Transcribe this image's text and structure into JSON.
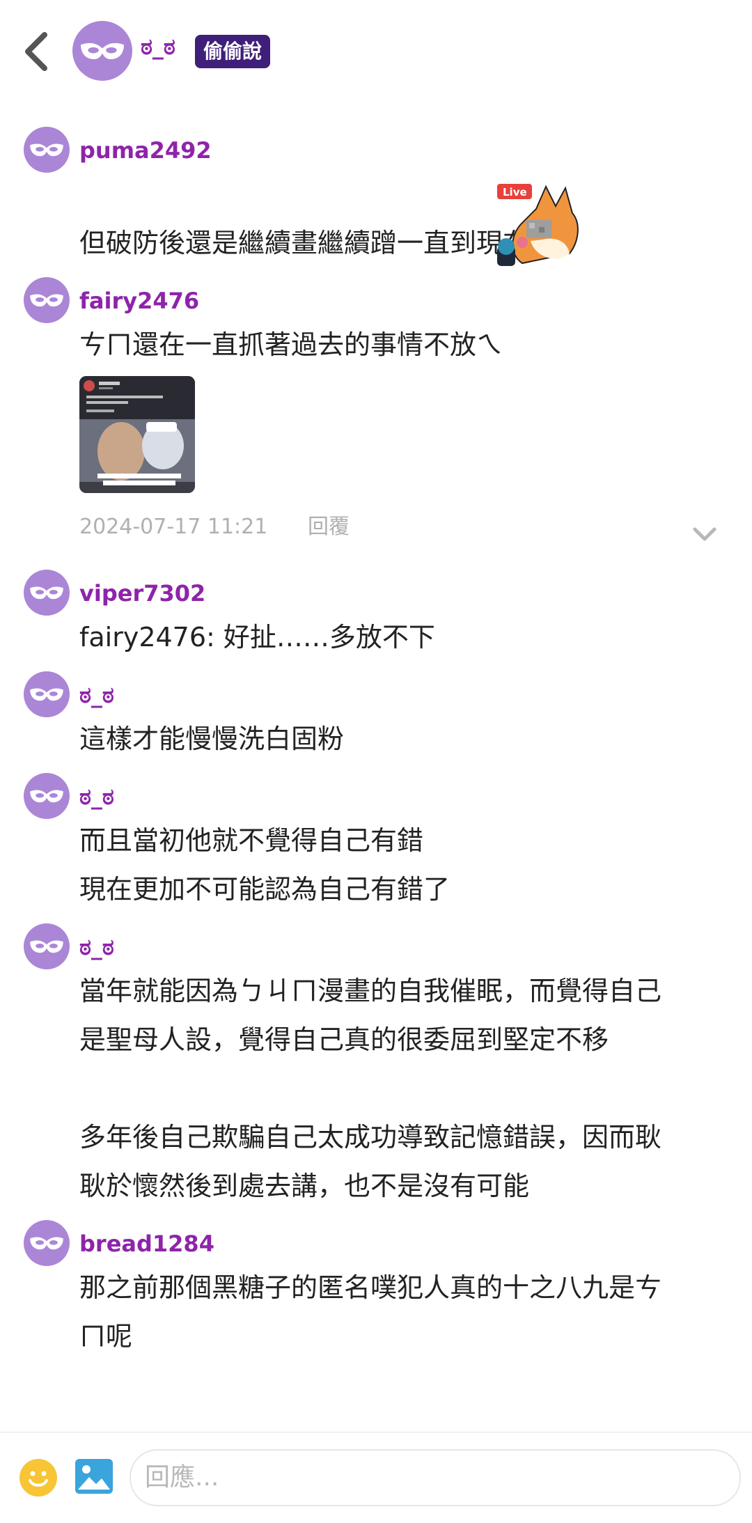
{
  "header": {
    "username": "ಠ_ಠ",
    "badge": "偷偷說",
    "icons": {
      "back": "chevron-left-icon",
      "avatar": "mask-icon"
    }
  },
  "comments": [
    {
      "username": "puma2492",
      "lines": [
        "但破防後還是繼續畫繼續蹭一直到現在"
      ],
      "sticker": "live-fox-sticker"
    },
    {
      "username": "fairy2476",
      "lines": [
        "ㄘㄇ還在一直抓著過去的事情不放ㄟ"
      ],
      "image": "attached-screenshot-thumbnail",
      "timestamp": "2024-07-17 11:21",
      "reply_label": "回覆"
    },
    {
      "username": "viper7302",
      "lines": [
        "fairy2476: 好扯……多放不下"
      ]
    },
    {
      "username": "ಠ_ಠ",
      "lines": [
        "這樣才能慢慢洗白固粉"
      ]
    },
    {
      "username": "ಠ_ಠ",
      "lines": [
        "而且當初他就不覺得自己有錯",
        "現在更加不可能認為自己有錯了"
      ]
    },
    {
      "username": "ಠ_ಠ",
      "paragraph1": [
        "當年就能因為ㄅㄐㄇ漫畫的自我催眠，而覺得自己",
        "是聖母人設，覺得自己真的很委屈到堅定不移"
      ],
      "paragraph2": [
        "多年後自己欺騙自己太成功導致記憶錯誤，因而耿",
        "耿於懷然後到處去講，也不是沒有可能"
      ]
    },
    {
      "username": "bread1284",
      "lines": [
        "那之前那個黑糖子的匿名噗犯人真的十之八九是ㄘ",
        "ㄇ呢"
      ]
    }
  ],
  "composer": {
    "placeholder": "回應...",
    "icons": {
      "emoji": "smile-icon",
      "image": "image-icon"
    }
  },
  "colors": {
    "username": "#8e24aa",
    "avatar": "#ab86d6",
    "badge": "#3f1f7a"
  }
}
